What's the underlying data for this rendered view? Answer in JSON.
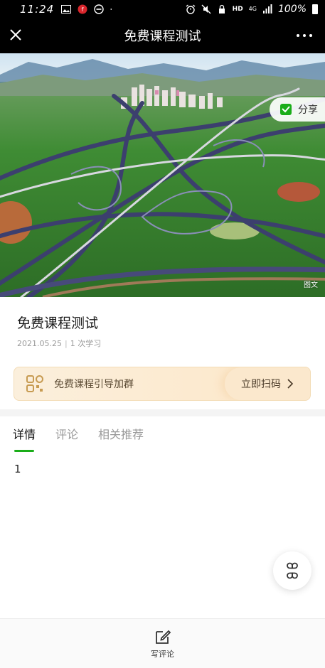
{
  "status_bar": {
    "time": "11:24",
    "network": "HD",
    "signal": "4G",
    "battery": "100%"
  },
  "nav": {
    "title": "免费课程测试"
  },
  "hero": {
    "share_label": "分享",
    "tag": "图文"
  },
  "course": {
    "title": "免费课程测试",
    "date": "2021.05.25",
    "separator": "|",
    "study_count": "1 次学习"
  },
  "banner": {
    "text": "免费课程引导加群",
    "cta": "立即扫码"
  },
  "tabs": [
    {
      "label": "详情"
    },
    {
      "label": "评论"
    },
    {
      "label": "相关推荐"
    }
  ],
  "content": {
    "body": "1"
  },
  "bottom": {
    "comment_label": "写评论"
  },
  "colors": {
    "accent_green": "#1aad19",
    "banner_bg": "#fbefdc",
    "nav_bg": "#000000"
  }
}
